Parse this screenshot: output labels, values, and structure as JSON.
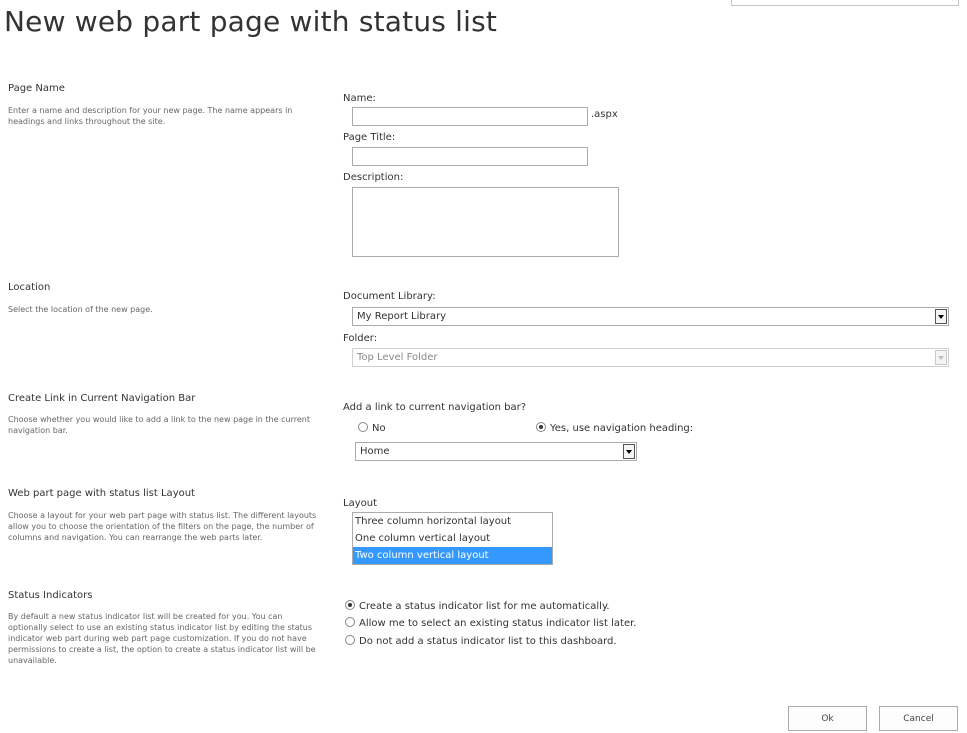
{
  "page": {
    "title": "New web part page with status list"
  },
  "sections": {
    "page_name": {
      "title": "Page Name",
      "description": "Enter a name and description for your new page. The name appears in headings and links throughout the site.",
      "name_label": "Name:",
      "name_value": "",
      "name_suffix": ".aspx",
      "page_title_label": "Page Title:",
      "page_title_value": "",
      "description_label": "Description:",
      "description_value": ""
    },
    "location": {
      "title": "Location",
      "description": "Select the location of the new page.",
      "library_label": "Document Library:",
      "library_value": "My Report Library",
      "folder_label": "Folder:",
      "folder_value": "Top Level Folder"
    },
    "nav_link": {
      "title": "Create Link in Current Navigation Bar",
      "description": "Choose whether you would like to add a link to the new page in the current navigation bar.",
      "question": "Add a link to current navigation bar?",
      "option_no": "No",
      "option_yes": "Yes, use navigation heading:",
      "selected": "yes",
      "heading_value": "Home"
    },
    "layout": {
      "title": "Web part page with status list Layout",
      "description": "Choose a layout for your web part page with status list. The different layouts allow you to choose the orientation of the filters on the page, the number of columns and navigation. You can rearrange the web parts later.",
      "label": "Layout",
      "options": [
        "Three column horizontal layout",
        "One column vertical layout",
        "Two column vertical layout"
      ],
      "selected_index": 2
    },
    "status": {
      "title": "Status Indicators",
      "description": "By default a new status indicator list will be created for you. You can optionally select to use an existing status indicator list by editing the status indicator web part during web part page customization. If you do not have permissions to create a list, the option to create a status indicator list will be unavailable.",
      "options": [
        "Create a status indicator list for me automatically.",
        "Allow me to select an existing status indicator list later.",
        "Do not add a status indicator list to this dashboard."
      ],
      "selected_index": 0
    }
  },
  "buttons": {
    "ok": "Ok",
    "cancel": "Cancel"
  },
  "colors": {
    "selection": "#3399ff"
  },
  "icons": {
    "search": "search-icon",
    "dropdown": "chevron-down-icon"
  }
}
